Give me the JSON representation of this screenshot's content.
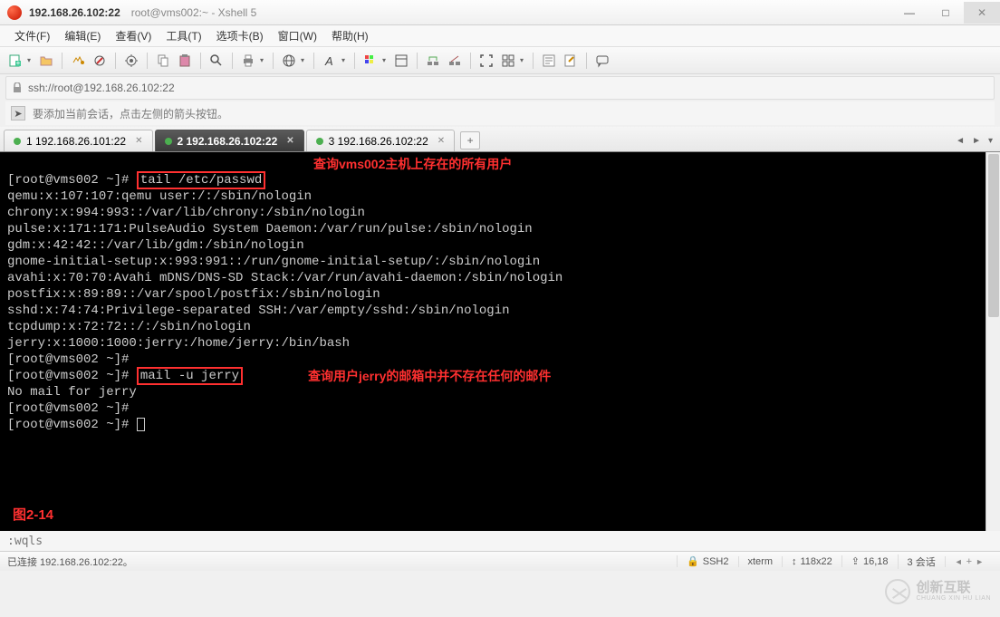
{
  "window": {
    "title": "192.168.26.102:22",
    "subtitle": "root@vms002:~ - Xshell 5"
  },
  "menu": {
    "file": "文件(F)",
    "edit": "编辑(E)",
    "view": "查看(V)",
    "tools": "工具(T)",
    "tab": "选项卡(B)",
    "window": "窗口(W)",
    "help": "帮助(H)"
  },
  "address": {
    "url": "ssh://root@192.168.26.102:22"
  },
  "hint": {
    "text": "要添加当前会话，点击左侧的箭头按钮。"
  },
  "tabs": [
    {
      "label": "1 192.168.26.101:22",
      "active": false
    },
    {
      "label": "2 192.168.26.102:22",
      "active": true
    },
    {
      "label": "3 192.168.26.102:22",
      "active": false
    }
  ],
  "terminal": {
    "lines": [
      {
        "prompt": "[root@vms002 ~]# ",
        "cmd": "tail /etc/passwd",
        "boxed": true
      },
      {
        "text": "qemu:x:107:107:qemu user:/:/sbin/nologin"
      },
      {
        "text": "chrony:x:994:993::/var/lib/chrony:/sbin/nologin"
      },
      {
        "text": "pulse:x:171:171:PulseAudio System Daemon:/var/run/pulse:/sbin/nologin"
      },
      {
        "text": "gdm:x:42:42::/var/lib/gdm:/sbin/nologin"
      },
      {
        "text": "gnome-initial-setup:x:993:991::/run/gnome-initial-setup/:/sbin/nologin"
      },
      {
        "text": "avahi:x:70:70:Avahi mDNS/DNS-SD Stack:/var/run/avahi-daemon:/sbin/nologin"
      },
      {
        "text": "postfix:x:89:89::/var/spool/postfix:/sbin/nologin"
      },
      {
        "text": "sshd:x:74:74:Privilege-separated SSH:/var/empty/sshd:/sbin/nologin"
      },
      {
        "text": "tcpdump:x:72:72::/:/sbin/nologin"
      },
      {
        "text": "jerry:x:1000:1000:jerry:/home/jerry:/bin/bash"
      },
      {
        "prompt": "[root@vms002 ~]#",
        "cmd": ""
      },
      {
        "prompt": "[root@vms002 ~]# ",
        "cmd": "mail -u jerry",
        "boxed": true
      },
      {
        "text": "No mail for jerry"
      },
      {
        "prompt": "[root@vms002 ~]#",
        "cmd": ""
      },
      {
        "prompt": "[root@vms002 ~]# ",
        "cmd": "",
        "cursor": true
      }
    ],
    "annotation1": "查询vms002主机上存在的所有用户",
    "annotation2": "查询用户jerry的邮箱中并不存在任何的邮件",
    "figure_label": "图2-14"
  },
  "cmdline": ":wqls",
  "status": {
    "connection": "已连接 192.168.26.102:22。",
    "protocol": "SSH2",
    "term": "xterm",
    "size": "118x22",
    "cursor": "16,18",
    "sessions": "3 会话"
  },
  "watermark": {
    "line1": "创新互联",
    "line2": "CHUANG XIN HU LIAN"
  },
  "icons": {
    "min": "—",
    "max": "□",
    "close": "✕",
    "add": "+",
    "arrow": "➤",
    "lock": "🔒",
    "updown": "↕",
    "caps": "⇪",
    "left": "◄",
    "right": "►",
    "dd": "▾"
  }
}
